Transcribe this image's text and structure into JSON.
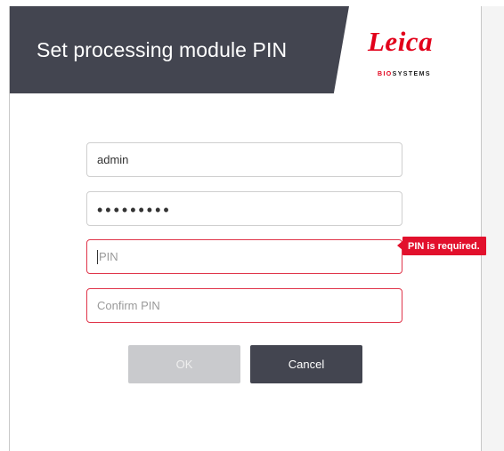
{
  "dialog": {
    "title": "Set processing module PIN",
    "logo": {
      "wordmark": "Leica",
      "sub_bio": "BIO",
      "sub_systems": "SYSTEMS"
    }
  },
  "form": {
    "username": {
      "value": "admin"
    },
    "password": {
      "value": "•••••••••"
    },
    "pin": {
      "value": "",
      "placeholder": "PIN",
      "error": "PIN is required."
    },
    "confirm_pin": {
      "value": "",
      "placeholder": "Confirm PIN"
    }
  },
  "buttons": {
    "ok_label": "OK",
    "cancel_label": "Cancel"
  },
  "colors": {
    "header": "#434550",
    "brand_red": "#e2001a",
    "error": "#e2102c",
    "disabled_button": "#c9cacd"
  }
}
